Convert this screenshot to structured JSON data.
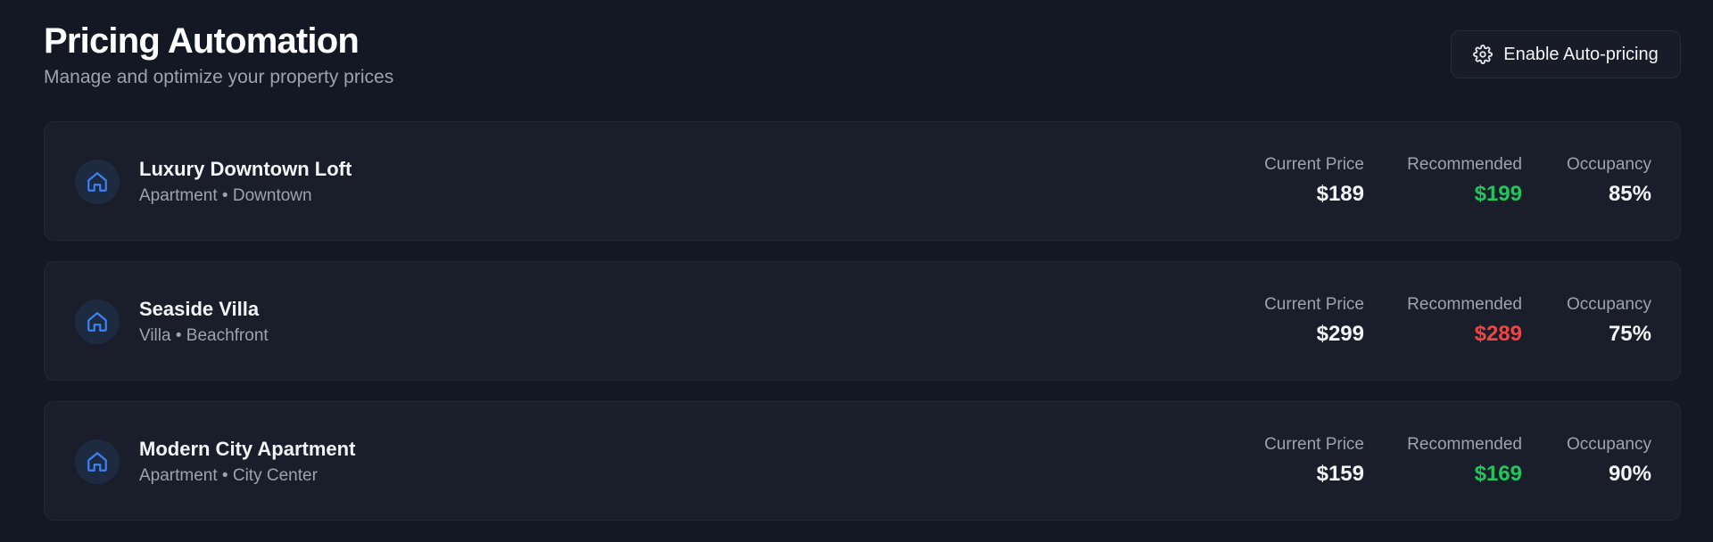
{
  "header": {
    "title": "Pricing Automation",
    "subtitle": "Manage and optimize your property prices",
    "enable_button_label": "Enable Auto-pricing",
    "enable_button_icon": "gear-icon"
  },
  "labels": {
    "current_price": "Current Price",
    "recommended": "Recommended",
    "occupancy": "Occupancy"
  },
  "colors": {
    "background": "#141824",
    "card": "#1a1e2a",
    "accent_blue": "#3b82f6",
    "increase_green": "#22c55e",
    "decrease_red": "#ef4444"
  },
  "properties": [
    {
      "name": "Luxury Downtown Loft",
      "meta": "Apartment • Downtown",
      "icon": "house-icon",
      "current_price": "$189",
      "recommended": "$199",
      "recommended_color": "#22c55e",
      "occupancy": "85%"
    },
    {
      "name": "Seaside Villa",
      "meta": "Villa • Beachfront",
      "icon": "house-icon",
      "current_price": "$299",
      "recommended": "$289",
      "recommended_color": "#ef4444",
      "occupancy": "75%"
    },
    {
      "name": "Modern City Apartment",
      "meta": "Apartment • City Center",
      "icon": "house-icon",
      "current_price": "$159",
      "recommended": "$169",
      "recommended_color": "#22c55e",
      "occupancy": "90%"
    }
  ]
}
